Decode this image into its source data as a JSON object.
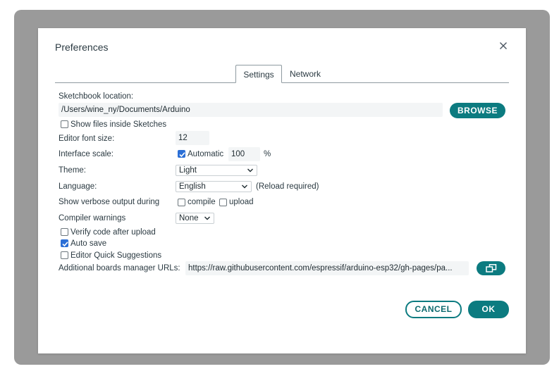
{
  "dialog": {
    "title": "Preferences",
    "close_icon": "close-icon"
  },
  "tabs": [
    {
      "label": "Settings",
      "active": true
    },
    {
      "label": "Network",
      "active": false
    }
  ],
  "settings": {
    "sketchbook_label": "Sketchbook location:",
    "sketchbook_path": "/Users/wine_ny/Documents/Arduino",
    "browse_label": "BROWSE",
    "show_files_label": "Show files inside Sketches",
    "show_files_checked": false,
    "font_size_label": "Editor font size:",
    "font_size_value": "12",
    "interface_scale_label": "Interface scale:",
    "automatic_label": "Automatic",
    "automatic_checked": true,
    "scale_value": "100",
    "scale_unit": "%",
    "theme_label": "Theme:",
    "theme_value": "Light",
    "language_label": "Language:",
    "language_value": "English",
    "reload_note": "(Reload required)",
    "verbose_label": "Show verbose output during",
    "compile_label": "compile",
    "compile_checked": false,
    "upload_label": "upload",
    "upload_checked": false,
    "compiler_warnings_label": "Compiler warnings",
    "compiler_warnings_value": "None",
    "verify_label": "Verify code after upload",
    "verify_checked": false,
    "autosave_label": "Auto save",
    "autosave_checked": true,
    "quick_suggestions_label": "Editor Quick Suggestions",
    "quick_suggestions_checked": false,
    "boards_urls_label": "Additional boards manager URLs:",
    "boards_urls_value": "https://raw.githubusercontent.com/espressif/arduino-esp32/gh-pages/pa..."
  },
  "footer": {
    "cancel_label": "CANCEL",
    "ok_label": "OK"
  },
  "colors": {
    "accent": "#0c7b80",
    "checkbox": "#2b6fd6",
    "field_bg": "#f3f5f6"
  }
}
